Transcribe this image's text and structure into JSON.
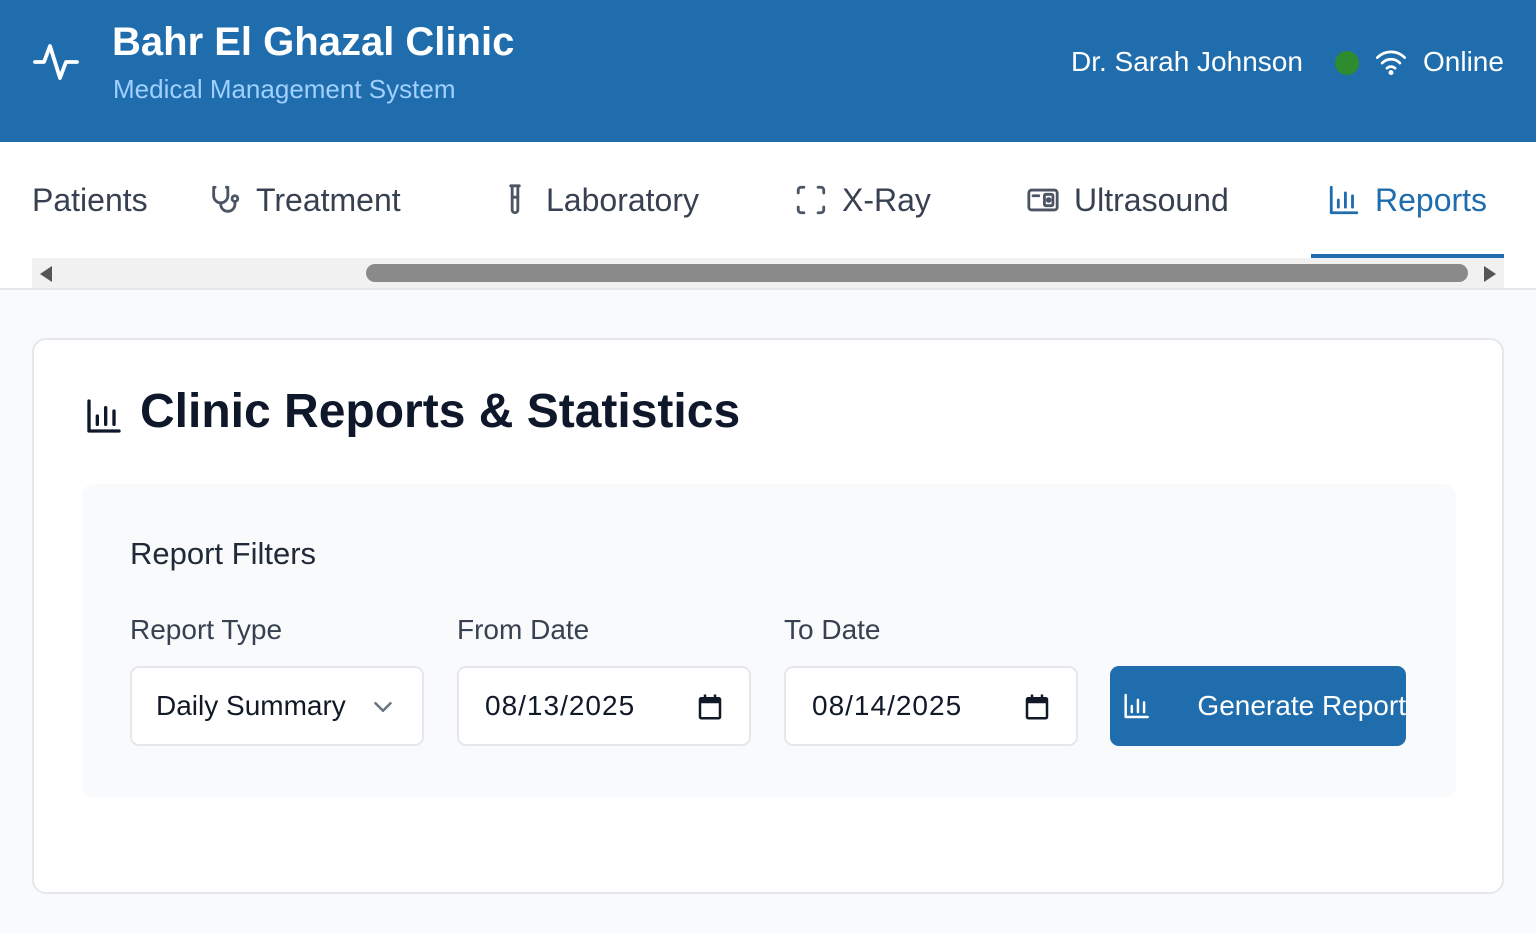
{
  "header": {
    "title": "Bahr El Ghazal Clinic",
    "subtitle": "Medical Management System",
    "user_name": "Dr. Sarah Johnson",
    "status_text": "Online",
    "status_color": "#2e8b2e",
    "brand_color": "#206dad"
  },
  "nav": {
    "tabs": [
      {
        "label": "Patients",
        "icon": "users-icon",
        "active": false
      },
      {
        "label": "Treatment",
        "icon": "stethoscope-icon",
        "active": false
      },
      {
        "label": "Laboratory",
        "icon": "test-tube-icon",
        "active": false
      },
      {
        "label": "X-Ray",
        "icon": "scan-icon",
        "active": false
      },
      {
        "label": "Ultrasound",
        "icon": "ultrasound-icon",
        "active": false
      },
      {
        "label": "Reports",
        "icon": "bar-chart-icon",
        "active": true
      }
    ]
  },
  "reports": {
    "title": "Clinic Reports & Statistics",
    "filters": {
      "title": "Report Filters",
      "report_type_label": "Report Type",
      "report_type_value": "Daily Summary",
      "from_label": "From Date",
      "from_value": "08/13/2025",
      "to_label": "To Date",
      "to_value": "08/14/2025",
      "generate_label": "Generate Report"
    }
  }
}
